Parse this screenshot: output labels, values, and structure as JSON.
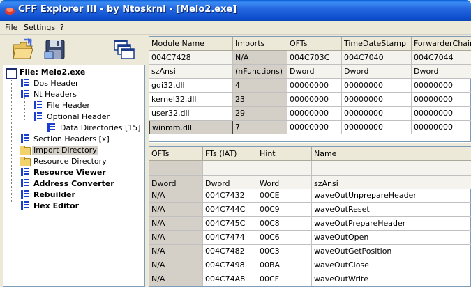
{
  "title": "CFF Explorer III - by Ntoskrnl - [Melo2.exe]",
  "menu": [
    "File",
    "Settings",
    "?"
  ],
  "toolbar": {
    "icons": [
      "open-folder-icon",
      "save-disk-icon",
      "windows-icon"
    ]
  },
  "tree": [
    {
      "label": "File: Melo2.exe",
      "icon": "file-icon",
      "bold": true,
      "level": 0
    },
    {
      "label": "Dos Header",
      "icon": "document-icon",
      "level": 1
    },
    {
      "label": "Nt Headers",
      "icon": "document-icon",
      "level": 1
    },
    {
      "label": "File Header",
      "icon": "document-icon",
      "level": 2
    },
    {
      "label": "Optional Header",
      "icon": "document-icon",
      "level": 2
    },
    {
      "label": "Data Directories [15]",
      "icon": "document-icon",
      "level": 3
    },
    {
      "label": "Section Headers [x]",
      "icon": "document-icon",
      "level": 1
    },
    {
      "label": "Import Directory",
      "icon": "folder-icon",
      "level": 1,
      "selected": true
    },
    {
      "label": "Resource Directory",
      "icon": "folder-icon",
      "level": 1
    },
    {
      "label": "Resource Viewer",
      "icon": "tool-icon",
      "bold": true,
      "level": 1
    },
    {
      "label": "Address Converter",
      "icon": "tool-icon",
      "bold": true,
      "level": 1
    },
    {
      "label": "Rebuilder",
      "icon": "tool-icon",
      "bold": true,
      "level": 1
    },
    {
      "label": "Hex Editor",
      "icon": "tool-icon",
      "bold": true,
      "level": 1
    }
  ],
  "modules_table": {
    "headers": [
      "Module Name",
      "Imports",
      "OFTs",
      "TimeDateStamp",
      "ForwarderChain"
    ],
    "offsets": [
      "004C7428",
      "N/A",
      "004C703C",
      "004C7040",
      "004C7044"
    ],
    "types": [
      "szAnsi",
      "(nFunctions)",
      "Dword",
      "Dword",
      "Dword"
    ],
    "rows": [
      [
        "gdi32.dll",
        "4",
        "00000000",
        "00000000",
        "00000000"
      ],
      [
        "kernel32.dll",
        "23",
        "00000000",
        "00000000",
        "00000000"
      ],
      [
        "user32.dll",
        "29",
        "00000000",
        "00000000",
        "00000000"
      ],
      [
        "winmm.dll",
        "7",
        "00000000",
        "00000000",
        "00000000"
      ]
    ],
    "selected_row": 3
  },
  "functions_table": {
    "headers": [
      "OFTs",
      "FTs (IAT)",
      "Hint",
      "Name"
    ],
    "types": [
      "Dword",
      "Dword",
      "Word",
      "szAnsi"
    ],
    "rows": [
      [
        "N/A",
        "004C7432",
        "00CE",
        "waveOutUnprepareHeader"
      ],
      [
        "N/A",
        "004C744C",
        "00C9",
        "waveOutReset"
      ],
      [
        "N/A",
        "004C745C",
        "00C8",
        "waveOutPrepareHeader"
      ],
      [
        "N/A",
        "004C7474",
        "00C6",
        "waveOutOpen"
      ],
      [
        "N/A",
        "004C7482",
        "00C3",
        "waveOutGetPosition"
      ],
      [
        "N/A",
        "004C7498",
        "00BA",
        "waveOutClose"
      ],
      [
        "N/A",
        "004C74A8",
        "00CF",
        "waveOutWrite"
      ]
    ]
  }
}
